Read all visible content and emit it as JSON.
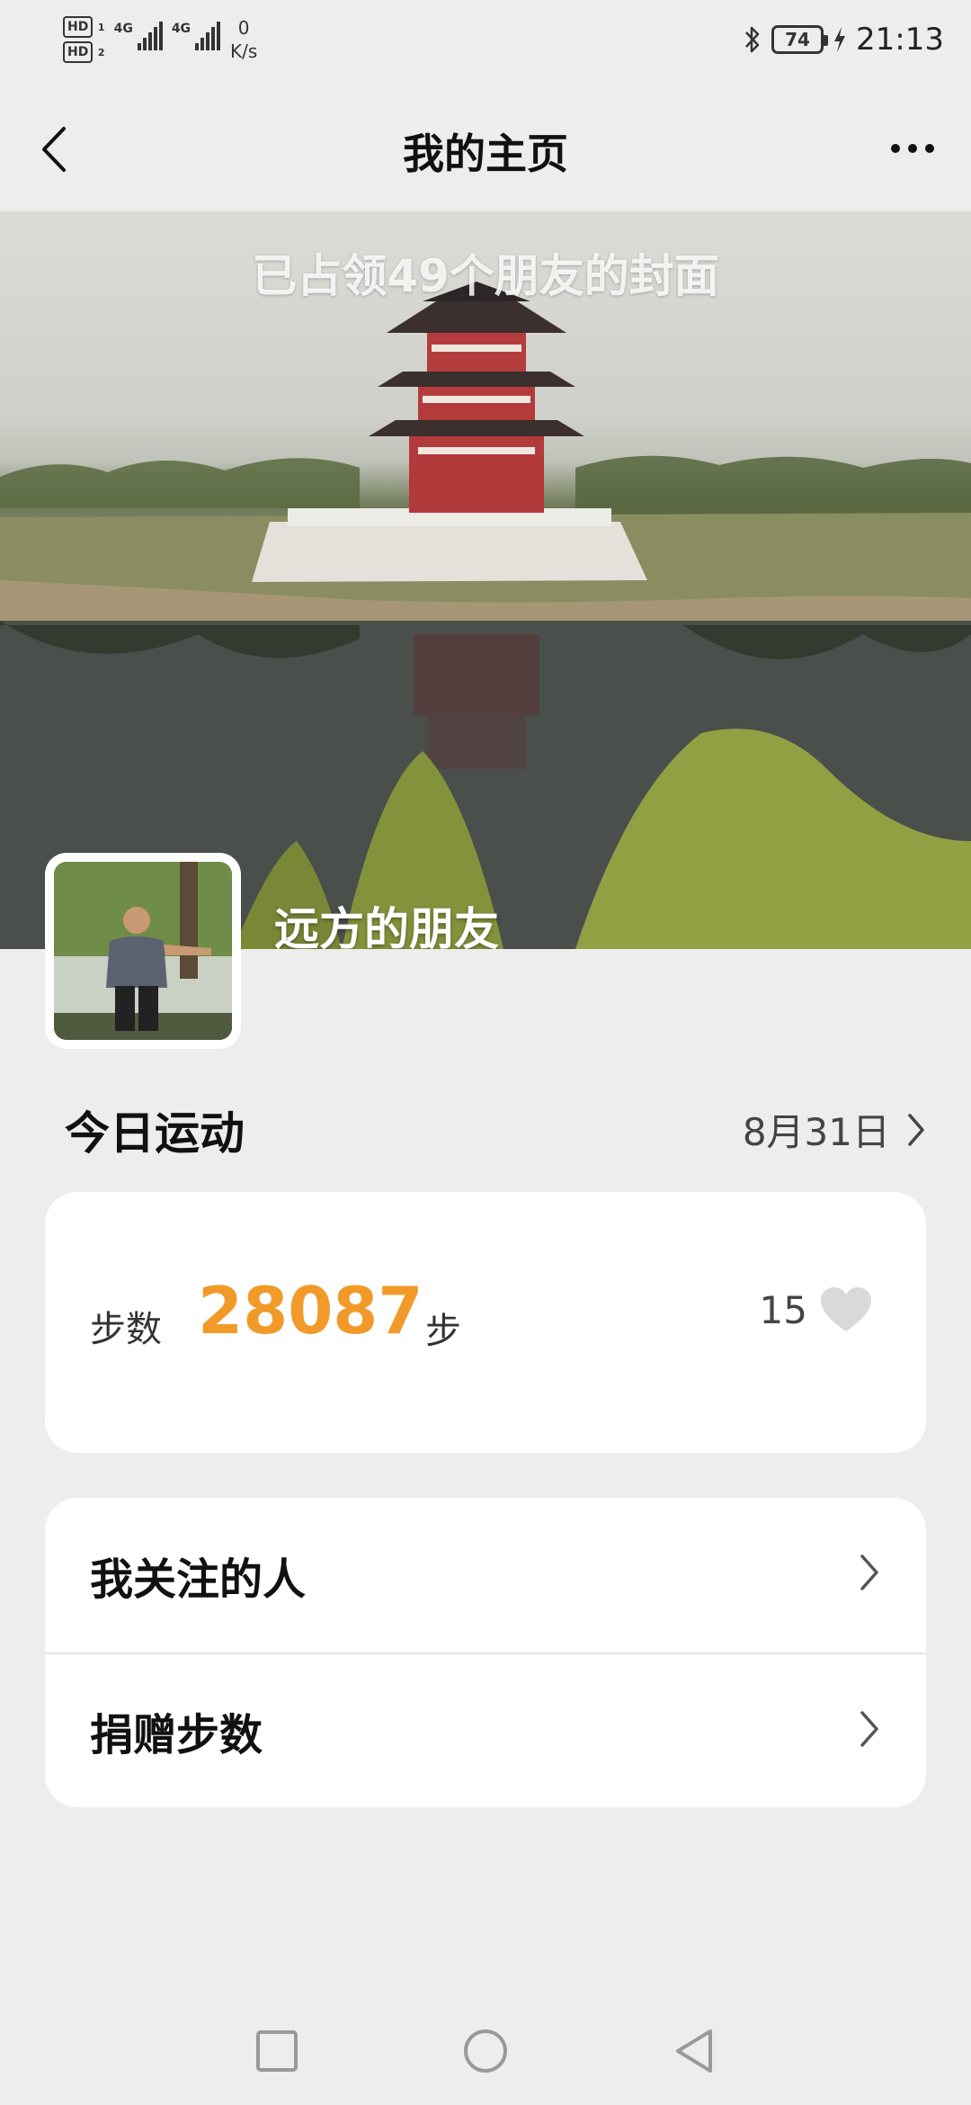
{
  "status_bar": {
    "hd1": "HD",
    "hd1_sub": "1",
    "hd2": "HD",
    "hd2_sub": "2",
    "sim1_net": "4G",
    "sim2_net": "4G",
    "net_speed_value": "0",
    "net_speed_unit": "K/s",
    "battery_level": "74",
    "time": "21:13"
  },
  "header": {
    "title": "我的主页"
  },
  "cover": {
    "caption": "已占领49个朋友的封面",
    "nickname": "远方的朋友"
  },
  "today": {
    "label": "今日运动",
    "date": "8月31日"
  },
  "steps": {
    "label": "步数",
    "value": "28087",
    "unit": "步",
    "likes": "15"
  },
  "menu": {
    "items": [
      {
        "label": "我关注的人"
      },
      {
        "label": "捐赠步数"
      }
    ]
  },
  "colors": {
    "steps_accent": "#f19a2a",
    "background": "#ededed",
    "card": "#ffffff"
  },
  "icons": {
    "back": "back-arrow-icon",
    "more": "more-dots-icon",
    "heart": "heart-icon",
    "chevron": "chevron-right-icon",
    "nav_recent": "square-icon",
    "nav_home": "circle-icon",
    "nav_back": "triangle-back-icon"
  }
}
